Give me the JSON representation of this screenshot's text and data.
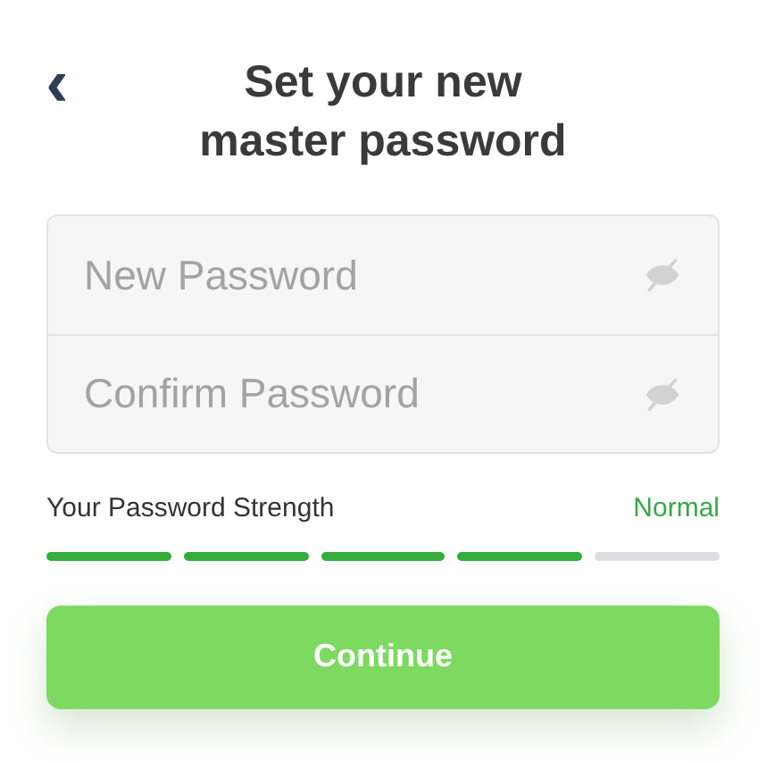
{
  "back_button": {
    "label": "‹"
  },
  "title": "Set your new master password",
  "fields": [
    {
      "placeholder": "New Password"
    },
    {
      "placeholder": "Confirm Password"
    }
  ],
  "strength": {
    "label": "Your Password Strength",
    "reading": "Normal",
    "level": 0.8
  },
  "buttons": [
    {
      "label": "Continue"
    }
  ]
}
